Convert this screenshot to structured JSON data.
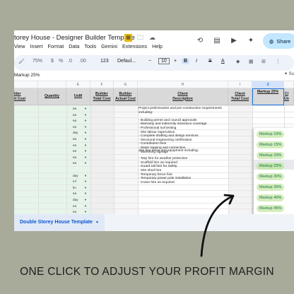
{
  "app": {
    "title": "torey House - Designer Builder Template",
    "menus": [
      "View",
      "Insert",
      "Format",
      "Data",
      "Tools",
      "Gemini",
      "Extensions",
      "Help"
    ],
    "share_label": "Share"
  },
  "toolbar": {
    "zoom": "75%",
    "format_dollar": "$",
    "format_percent": "%",
    "format_dec_less": ".0",
    "format_dec_more": ".00",
    "format_number": "123",
    "font": "Defaul...",
    "minus": "−",
    "font_size": "10",
    "plus": "+",
    "bold": "B",
    "italic": "I",
    "strike": "S",
    "text_color": "A"
  },
  "formula_bar": {
    "namebox": "Markup 25%",
    "right_label": "Su"
  },
  "columns": [
    "E",
    "F",
    "G",
    "H",
    "I",
    "J"
  ],
  "headers": {
    "builder_unit_cost": "lder\nit Cost",
    "quantity": "Quantity",
    "uom": "UoM",
    "builder_total_cost": "Builder\nTotal Cost",
    "builder_actual_cost": "Builder\nActual Cost",
    "client_description": "Client\nDescription",
    "client_total_cost": "Client\nTotal Cost",
    "markup": "Markup 25%",
    "client_unit": "Cl\nUn"
  },
  "uom_values": [
    "ea",
    "ea",
    "ea",
    "ea",
    "day",
    "ea",
    "ea",
    "ea",
    "ea",
    "ea",
    "",
    "day",
    "m²",
    "lm",
    "ea",
    "day",
    "ea",
    "ea",
    "hr"
  ],
  "descriptions": {
    "block1": "Project preliminaries and pre-construction requirements\nincluding:\n\n- Building permit and council approvals\n- Warranty and indemnity insurance coverage\n- Professional soil testing\n- Site labour supervision\n- Complete drafting and design services\n- Structural engineering certification\n- Contribution fees\n- Water tapping and connection\n- Marketing signage",
    "block2": "Site hire items and equipment including:\n\n- Tarp hire for weather protection\n- Scaffold hire as required\n- Guard rail hire for safety\n- Site shed hire\n- Temporary fence hire\n- Temporary power pole installation\n- Crane hire as required"
  },
  "markup_options": [
    "Markup 10%",
    "Markup 15%",
    "Markup 20%",
    "Markup 25%",
    "Markup 30%",
    "Markup 35%",
    "Markup 40%",
    "Markup 45%",
    "Markup 50%",
    "Markup 55%",
    "Markup 60%"
  ],
  "sheet_tab": "Double Storey House Template",
  "caption": "ONE CLICK TO ADJUST YOUR PROFIT MARGIN",
  "colors": {
    "share_bg": "#c2e7ff",
    "chip_bg": "#d4edbc",
    "chip_text": "#11734b",
    "background": "#a8aa9a",
    "header_grey": "#d9d9d9"
  }
}
